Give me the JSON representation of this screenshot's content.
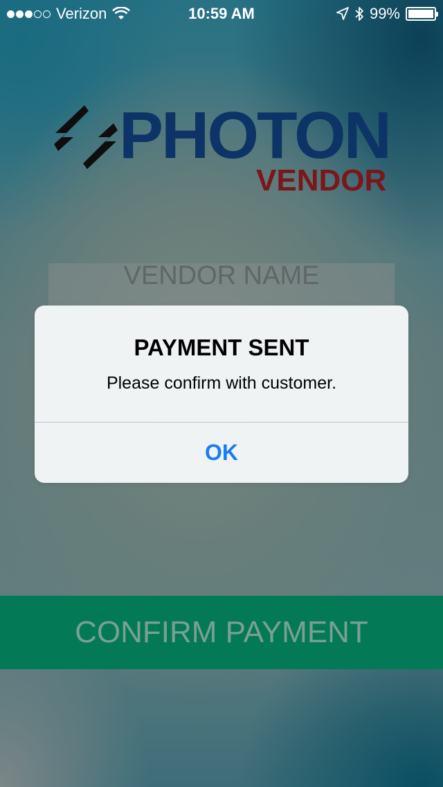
{
  "status_bar": {
    "carrier": "Verizon",
    "time": "10:59 AM",
    "battery": "99%",
    "battery_level": 0.99,
    "signal_bars_filled": 3,
    "signal_bars_total": 5,
    "icons": [
      "wifi-icon",
      "location-icon",
      "bluetooth-icon",
      "battery-icon"
    ]
  },
  "logo": {
    "primary": "PHOTON",
    "secondary": "VENDOR"
  },
  "form": {
    "vendor_name_placeholder": "VENDOR NAME",
    "confirm_label": "CONFIRM PAYMENT"
  },
  "alert": {
    "title": "PAYMENT SENT",
    "message": "Please confirm with customer.",
    "ok_label": "OK"
  },
  "colors": {
    "brand_blue": "#0e3c75",
    "brand_red": "#8c1a1f",
    "confirm_green": "#048a62",
    "ios_blue": "#1a7cf5"
  }
}
